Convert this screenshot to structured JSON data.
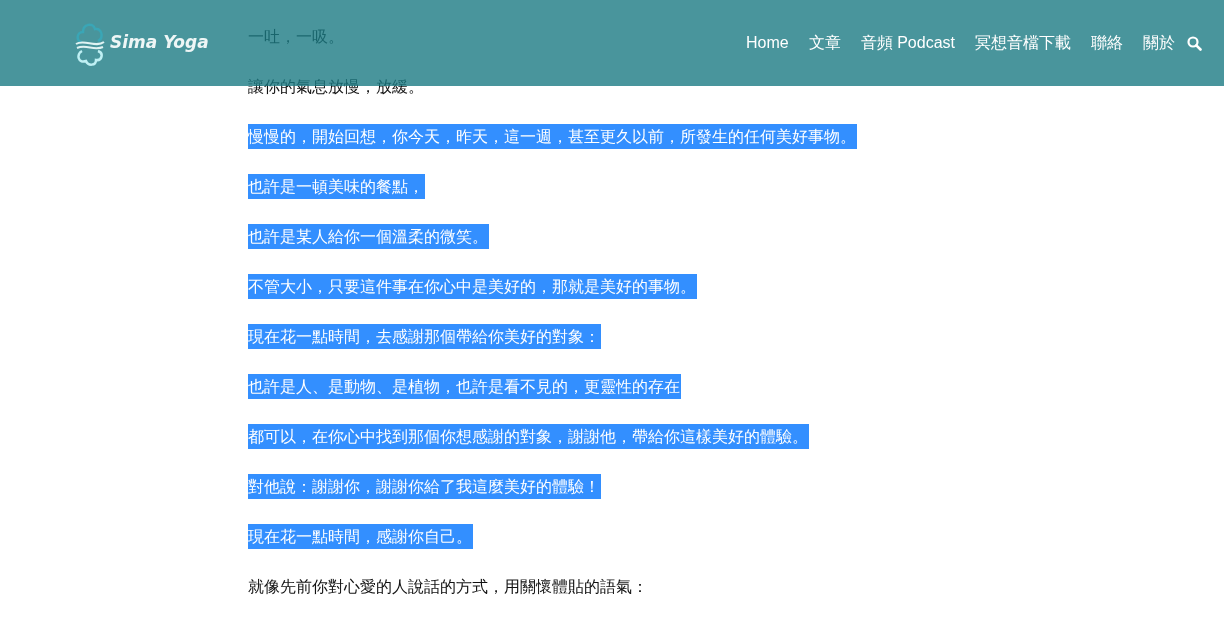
{
  "header": {
    "logo_text": "Sima Yoga",
    "nav": [
      {
        "label": "Home"
      },
      {
        "label": "文章"
      },
      {
        "label": "音頻 Podcast"
      },
      {
        "label": "冥想音檔下載"
      },
      {
        "label": "聯絡"
      },
      {
        "label": "關於"
      }
    ]
  },
  "paragraphs": [
    {
      "text": "一吐，一吸。",
      "selected": false
    },
    {
      "text": "讓你的氣息放慢，放緩。",
      "selected": false
    },
    {
      "text": "慢慢的，開始回想，你今天，昨天，這一週，甚至更久以前，所發生的任何美好事物。",
      "selected": true
    },
    {
      "text": "也許是一頓美味的餐點，",
      "selected": true
    },
    {
      "text": "也許是某人給你一個溫柔的微笑。",
      "selected": true
    },
    {
      "text": "不管大小，只要這件事在你心中是美好的，那就是美好的事物。",
      "selected": true
    },
    {
      "text": "現在花一點時間，去感謝那個帶給你美好的對象：",
      "selected": true
    },
    {
      "text": "也許是人、是動物、是植物，也許是看不見的，更靈性的存在",
      "selected": true
    },
    {
      "text": "都可以，在你心中找到那個你想感謝的對象，謝謝他，帶給你這樣美好的體驗。",
      "selected": true
    },
    {
      "text": "對他說：謝謝你，謝謝你給了我這麼美好的體驗！",
      "selected": true
    },
    {
      "text": "現在花一點時間，感謝你自己。",
      "selected": true
    },
    {
      "text": "就像先前你對心愛的人說話的方式，用關懷體貼的語氣：",
      "selected": false
    }
  ]
}
